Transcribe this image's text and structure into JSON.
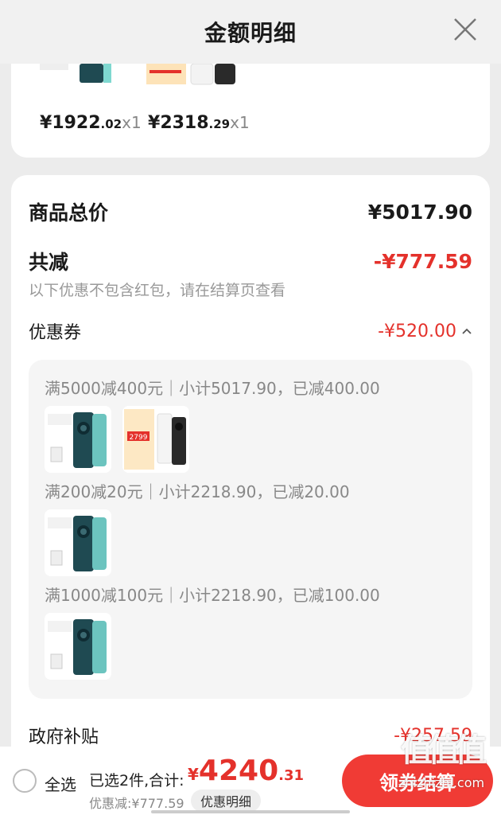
{
  "header": {
    "title": "金额明细"
  },
  "top_items": [
    {
      "currency": "¥",
      "int": "1922",
      "dec": ".02",
      "qty": "x1"
    },
    {
      "currency": "¥",
      "int": "2318",
      "dec": ".29",
      "qty": "x1"
    }
  ],
  "summary": {
    "total_label": "商品总价",
    "total_value": "¥5017.90",
    "reduce_label": "共减",
    "reduce_value": "-¥777.59",
    "note": "以下优惠不包含红包，请在结算页查看",
    "coupon_label": "优惠券",
    "coupon_value": "-¥520.00"
  },
  "coupons": [
    {
      "text": "满5000减400元｜小计5017.90，已减400.00"
    },
    {
      "text": "满200减20元｜小计2218.90，已减20.00"
    },
    {
      "text": "满1000减100元｜小计2218.90，已减100.00"
    }
  ],
  "product_image_badge": "2799",
  "gov": {
    "label": "政府补贴",
    "value": "-¥257.59"
  },
  "footer": {
    "select_all": "全选",
    "selected_info": "已选2件,合计:",
    "total_currency": "¥",
    "total_int": "4240",
    "total_dec": ".31",
    "discount": "优惠减:¥777.59",
    "detail_button": "优惠明细",
    "checkout": "领券结算"
  },
  "watermark": {
    "logo": "值值值",
    "site": "zhizhizhi.com"
  },
  "colors": {
    "accent_red": "#e4312b",
    "checkout_red": "#f03b35",
    "phone_teal": "#1f4a52"
  }
}
